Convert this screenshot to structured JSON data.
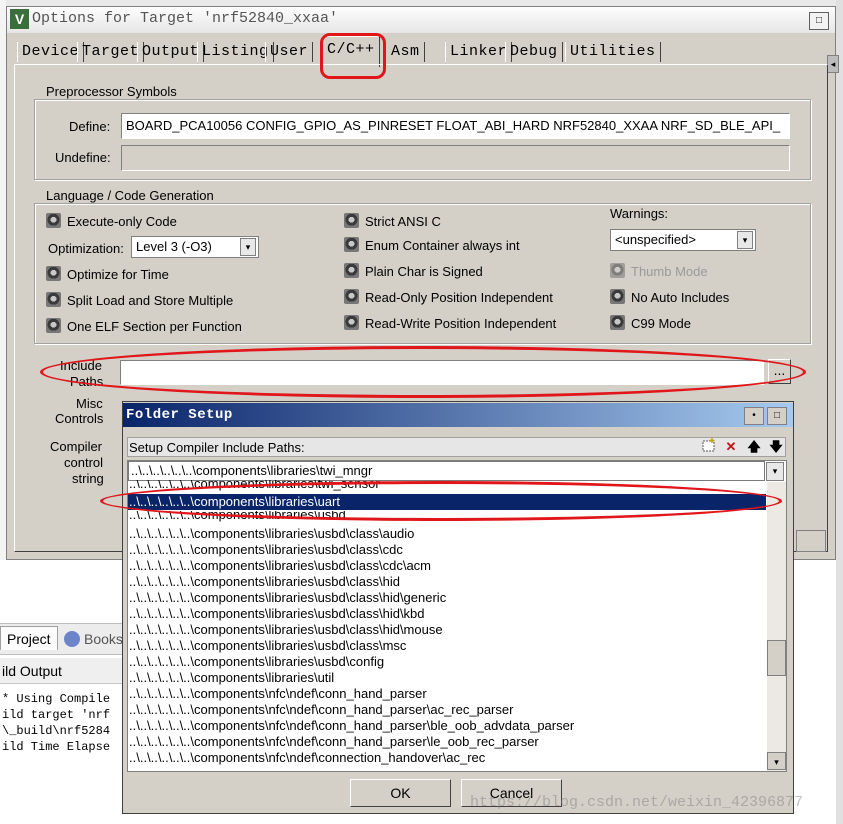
{
  "background_ide": {
    "project_tab": "Project",
    "books_tab": "Books",
    "build_output_header": "ild Output",
    "build_lines": [
      "* Using Compile",
      "ild target 'nrf",
      "\\_build\\nrf5284",
      "ild Time Elapse"
    ]
  },
  "dialog": {
    "title": "Options for Target 'nrf52840_xxaa'",
    "tabs": [
      "Device",
      "Target",
      "Output",
      "Listing",
      "User",
      "C/C++",
      "Asm",
      "Linker",
      "Debug",
      "Utilities"
    ],
    "active_tab": "C/C++"
  },
  "preprocessor": {
    "group_label": "Preprocessor Symbols",
    "define_label": "Define:",
    "define_value": "BOARD_PCA10056 CONFIG_GPIO_AS_PINRESET FLOAT_ABI_HARD NRF52840_XXAA NRF_SD_BLE_API_",
    "undefine_label": "Undefine:",
    "undefine_value": ""
  },
  "language": {
    "group_label": "Language / Code Generation",
    "execute_only": "Execute-only Code",
    "optimization_label": "Optimization:",
    "optimization_value": "Level 3 (-O3)",
    "optimize_time": "Optimize for Time",
    "split_load": "Split Load and Store Multiple",
    "one_elf": "One ELF Section per Function",
    "strict_ansi": "Strict ANSI C",
    "enum_int": "Enum Container always int",
    "plain_char": "Plain Char is Signed",
    "ro_pi": "Read-Only Position Independent",
    "rw_pi": "Read-Write Position Independent",
    "warnings_label": "Warnings:",
    "warnings_value": "<unspecified>",
    "thumb_mode": "Thumb Mode",
    "no_auto_includes": "No Auto Includes",
    "c99_mode": "C99 Mode"
  },
  "include_paths": {
    "label_line1": "Include",
    "label_line2": "Paths",
    "value": "",
    "browse": "..."
  },
  "misc_controls": {
    "line1": "Misc",
    "line2": "Controls"
  },
  "compiler_control": {
    "line1": "Compiler",
    "line2": "control",
    "line3": "string"
  },
  "folder_setup": {
    "title": "Folder Setup",
    "header_label": "Setup Compiler Include Paths:",
    "edit_row": "..\\..\\..\\..\\..\\..\\components\\libraries\\twi_mngr",
    "items": [
      "..\\..\\..\\..\\..\\..\\components\\libraries\\twi_sensor",
      "..\\..\\..\\..\\..\\..\\components\\libraries\\uart",
      "..\\..\\..\\..\\..\\..\\components\\libraries\\usbd",
      "..\\..\\..\\..\\..\\..\\components\\libraries\\usbd\\class\\audio",
      "..\\..\\..\\..\\..\\..\\components\\libraries\\usbd\\class\\cdc",
      "..\\..\\..\\..\\..\\..\\components\\libraries\\usbd\\class\\cdc\\acm",
      "..\\..\\..\\..\\..\\..\\components\\libraries\\usbd\\class\\hid",
      "..\\..\\..\\..\\..\\..\\components\\libraries\\usbd\\class\\hid\\generic",
      "..\\..\\..\\..\\..\\..\\components\\libraries\\usbd\\class\\hid\\kbd",
      "..\\..\\..\\..\\..\\..\\components\\libraries\\usbd\\class\\hid\\mouse",
      "..\\..\\..\\..\\..\\..\\components\\libraries\\usbd\\class\\msc",
      "..\\..\\..\\..\\..\\..\\components\\libraries\\usbd\\config",
      "..\\..\\..\\..\\..\\..\\components\\libraries\\util",
      "..\\..\\..\\..\\..\\..\\components\\nfc\\ndef\\conn_hand_parser",
      "..\\..\\..\\..\\..\\..\\components\\nfc\\ndef\\conn_hand_parser\\ac_rec_parser",
      "..\\..\\..\\..\\..\\..\\components\\nfc\\ndef\\conn_hand_parser\\ble_oob_advdata_parser",
      "..\\..\\..\\..\\..\\..\\components\\nfc\\ndef\\conn_hand_parser\\le_oob_rec_parser",
      "..\\..\\..\\..\\..\\..\\components\\nfc\\ndef\\connection_handover\\ac_rec"
    ],
    "selected_item": "..\\..\\..\\..\\..\\..\\components\\libraries\\uart",
    "ok": "OK",
    "cancel": "Cancel"
  },
  "watermark": "https://blog.csdn.net/weixin_42396877",
  "colors": {
    "highlight": "#e0161b",
    "selection": "#0a246a",
    "dialog_bg": "#d4d0c8"
  }
}
